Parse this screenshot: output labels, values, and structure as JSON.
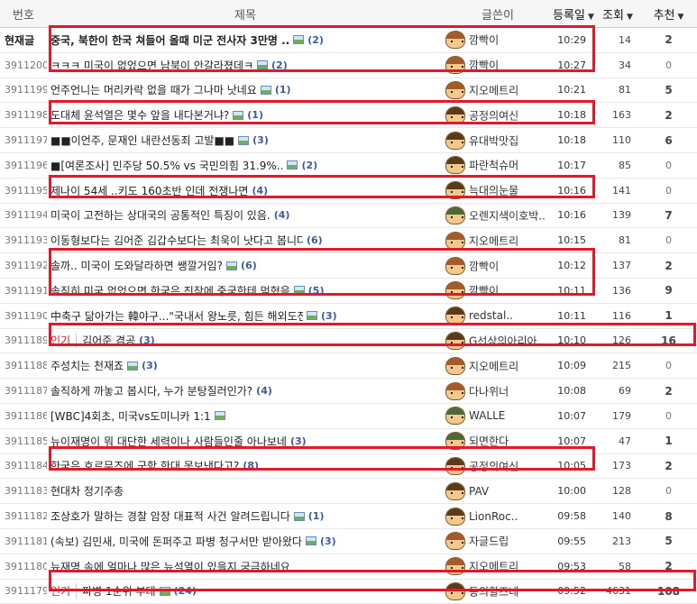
{
  "header": {
    "no": "번호",
    "title": "제목",
    "author": "글쓴이",
    "date": "등록일",
    "views": "조회",
    "rec": "추천",
    "caret": "▼"
  },
  "rows": [
    {
      "no": "현재글",
      "title": "중국, 북한이 한국 쳐들어 올때 미군 전사자 3만명 ..",
      "img": true,
      "comments": "(2)",
      "author": "깜빡이",
      "avatar": "rust",
      "time": "10:29",
      "views": "14",
      "rec": "2",
      "current": true
    },
    {
      "no": "3911200",
      "title": "ㅋㅋㅋ 미국이 없었으면 남북이 안갈라졌데ㅋ",
      "img": true,
      "comments": "(2)",
      "author": "깜빡이",
      "avatar": "rust",
      "time": "10:27",
      "views": "34",
      "rec": "0"
    },
    {
      "no": "3911199",
      "title": "언주언니는 머리카락 없을 때가 그나마 낫네요",
      "img": true,
      "comments": "(1)",
      "author": "지오메트리",
      "avatar": "rust",
      "time": "10:21",
      "views": "81",
      "rec": "5"
    },
    {
      "no": "3911198",
      "title": "도대체 윤석열은 몇수 앞을 내다본거냐?",
      "img": true,
      "comments": "(1)",
      "author": "공정의여신",
      "avatar": "brown",
      "time": "10:18",
      "views": "163",
      "rec": "2"
    },
    {
      "no": "3911197",
      "title": "■■이언주, 문재인 내란선동죄 고발■■",
      "img": true,
      "comments": "(3)",
      "author": "유대박맛집",
      "avatar": "brown",
      "time": "10:18",
      "views": "110",
      "rec": "6"
    },
    {
      "no": "3911196",
      "title": "■[여론조사] 민주당 50.5% vs 국민의힘 31.9%..",
      "img": true,
      "comments": "(2)",
      "author": "파란척슈머",
      "avatar": "brown",
      "time": "10:17",
      "views": "85",
      "rec": "0"
    },
    {
      "no": "3911195",
      "title": "제나이 54세 ..키도 160초반 인데 전쟁나면",
      "img": false,
      "comments": "(4)",
      "author": "늑대의눈물",
      "avatar": "brown",
      "time": "10:16",
      "views": "141",
      "rec": "0"
    },
    {
      "no": "3911194",
      "title": "미국이 고전하는 상대국의 공통적인 특징이 있음.",
      "img": false,
      "comments": "(4)",
      "author": "오렌지색이호박..",
      "avatar": "cap",
      "time": "10:16",
      "views": "139",
      "rec": "7"
    },
    {
      "no": "3911193",
      "title": "이동형보다는 김어준 김갑수보다는 최욱이 낫다고 봅니다",
      "img": false,
      "comments": "(6)",
      "author": "지오메트리",
      "avatar": "rust",
      "time": "10:15",
      "views": "81",
      "rec": "0"
    },
    {
      "no": "3911192",
      "title": "솔까.. 미국이 도와달라하면 쌩깔거임?",
      "img": true,
      "comments": "(6)",
      "author": "깜빡이",
      "avatar": "rust",
      "time": "10:12",
      "views": "137",
      "rec": "2"
    },
    {
      "no": "3911191",
      "title": "솔직히 미국 없었으면 한국은 진작에 중국한테 먹혔음",
      "img": true,
      "comments": "(5)",
      "author": "깜빡이",
      "avatar": "rust",
      "time": "10:11",
      "views": "136",
      "rec": "9"
    },
    {
      "no": "3911190",
      "title": "中축구 닮아가는 韓야구...\"국내서 왕노릇, 힘든 해외도전 ..",
      "img": true,
      "comments": "(3)",
      "author": "redstal..",
      "avatar": "brown",
      "time": "10:11",
      "views": "116",
      "rec": "1"
    },
    {
      "no": "3911189",
      "badge": "인기",
      "title": "김어준 겸공",
      "img": false,
      "comments": "(3)",
      "author": "G선상의아리아",
      "avatar": "brown",
      "time": "10:10",
      "views": "126",
      "rec": "16"
    },
    {
      "no": "3911188",
      "title": "주성치는 천재죠",
      "img": true,
      "comments": "(3)",
      "author": "지오메트리",
      "avatar": "rust",
      "time": "10:09",
      "views": "215",
      "rec": "0"
    },
    {
      "no": "3911187",
      "title": "솔직하게 까놓고 봅시다, 누가 분탕질러인가?",
      "img": false,
      "comments": "(4)",
      "author": "다나위너",
      "avatar": "rust",
      "time": "10:08",
      "views": "69",
      "rec": "2"
    },
    {
      "no": "3911186",
      "title": "[WBC]4회초, 미국vs도미니카 1:1",
      "img": true,
      "comments": "",
      "author": "WALLE",
      "avatar": "cap",
      "time": "10:07",
      "views": "179",
      "rec": "0"
    },
    {
      "no": "3911185",
      "title": "뉴이재명이 뭐 대단한 세력이나 사람들인줄 아나보네",
      "img": false,
      "comments": "(3)",
      "author": "되면한다",
      "avatar": "cap",
      "time": "10:07",
      "views": "47",
      "rec": "1"
    },
    {
      "no": "3911184",
      "title": "한국은 호르무즈에 군함 한대 못보낸다고?",
      "img": false,
      "comments": "(8)",
      "author": "공정의여신",
      "avatar": "brown",
      "time": "10:05",
      "views": "173",
      "rec": "2"
    },
    {
      "no": "3911183",
      "title": "현대차 정기주총",
      "img": false,
      "comments": "",
      "author": "PAV",
      "avatar": "brown",
      "time": "10:00",
      "views": "128",
      "rec": "0"
    },
    {
      "no": "3911182",
      "title": "조상호가 말하는 경찰 암장 대표적 사건 알려드립니다",
      "img": true,
      "comments": "(1)",
      "author": "LionRoc..",
      "avatar": "brown",
      "time": "09:58",
      "views": "140",
      "rec": "8"
    },
    {
      "no": "3911181",
      "title": "(속보) 김민새, 미국에 돈퍼주고 파병 청구서만 받아왔다",
      "img": true,
      "comments": "(3)",
      "author": "자글드립",
      "avatar": "rust",
      "time": "09:55",
      "views": "213",
      "rec": "5"
    },
    {
      "no": "3911180",
      "title": "뉴재명 속에 얼마나 많은 뉴석열이 있을지 궁금하네요",
      "img": false,
      "comments": "",
      "author": "지오메트리",
      "avatar": "rust",
      "time": "09:53",
      "views": "58",
      "rec": "2"
    },
    {
      "no": "3911179",
      "badge": "인기",
      "title": "파병 1순위 부대",
      "img": true,
      "comments": "(24)",
      "author": "동의할즈네",
      "avatar": "brown",
      "time": "09:52",
      "views": "4631",
      "rec": "108"
    }
  ]
}
